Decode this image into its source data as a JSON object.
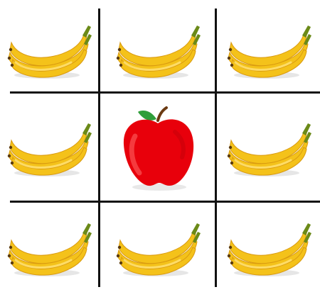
{
  "grid": {
    "rows": 3,
    "columns": 3,
    "cells": [
      {
        "item": "banana-icon"
      },
      {
        "item": "banana-icon"
      },
      {
        "item": "banana-icon"
      },
      {
        "item": "banana-icon"
      },
      {
        "item": "apple-icon"
      },
      {
        "item": "banana-icon"
      },
      {
        "item": "banana-icon"
      },
      {
        "item": "banana-icon"
      },
      {
        "item": "banana-icon"
      }
    ]
  },
  "colors": {
    "banana": "#f4c21a",
    "banana_shade": "#d99a10",
    "banana_stem": "#6b8a18",
    "apple": "#e8000b",
    "apple_highlight": "#ff6a6a",
    "leaf": "#2f9e3a",
    "grid_line": "#111111"
  }
}
